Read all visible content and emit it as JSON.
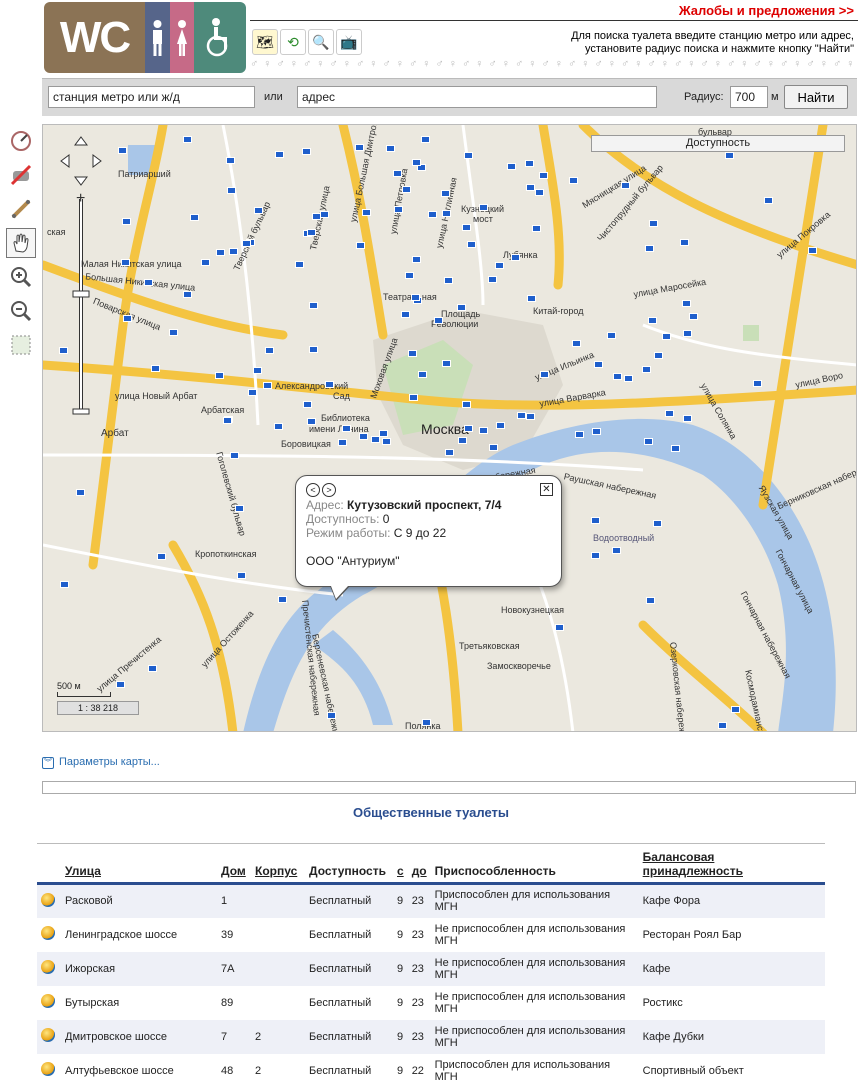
{
  "header": {
    "logo_text": "WC",
    "complaints_link": "Жалобы и предложения >>",
    "hint_line1": "Для поиска туалета введите станцию метро или адрес,",
    "hint_line2": "установите радиус поиска и нажмите кнопку \"Найти\"",
    "tool_icons": [
      "map-layers-icon",
      "route-icon",
      "magnifier-search-icon",
      "tv-icon"
    ]
  },
  "search": {
    "station_value": "станция метро или ж/д",
    "or_label": "или",
    "address_value": "адрес",
    "radius_label": "Радиус:",
    "radius_value": "700",
    "radius_unit": "м",
    "find_button": "Найти"
  },
  "left_tools": [
    "compass-icon",
    "no-drive-icon",
    "ruler-icon",
    "hand-pan-icon",
    "zoom-in-icon",
    "zoom-out-icon",
    "area-select-icon"
  ],
  "map": {
    "accessibility_button": "Доступность",
    "city_label": "Москва",
    "scale_text": "500 м",
    "scale_ratio": "1 : 38 218",
    "labels": {
      "patriarshiy": "Патриарший",
      "bulvar": "бульвар",
      "kuznetsky": "Кузнецкий",
      "most": "мост",
      "lubyanka": "Лубянка",
      "teatralnaya": "Театральная",
      "ploschad": "Площадь",
      "revolyutsii": "Революции",
      "kitay_gorod": "Китай-город",
      "aleksandrovsky": "Александровский",
      "sad": "Сад",
      "biblioteka": "Библиотека",
      "imeni_lenina": "имени Ленина",
      "arbatskaya": "Арбатская",
      "borovitskaya": "Боровицкая",
      "arbat": "Арбат",
      "kropotkinskaya": "Кропоткинская",
      "novokuznetskaya": "Новокузнецкая",
      "tretyakovskaya": "Третьяковская",
      "zamoskvorechye": "Замоскворечье",
      "polyanka": "Полянка",
      "vodootvodny": "Водоотводный",
      "skaya": "ская"
    },
    "streets": {
      "tverskaya": "Тверская улица",
      "b_dmitrovka": "улица Большая Дмитровка",
      "petrovka": "улица Петровка",
      "neglinnaya": "улица Неглинная",
      "tverskoy_bulvar": "Тверской бульвар",
      "m_nikitskaya": "Малая Никитская улица",
      "b_nikitskaya": "Большая Никитская улица",
      "povarskaya": "Поварская улица",
      "novy_arbat": "улица Новый Арбат",
      "mokhovaya": "Моховая улица",
      "gogolevsky": "Гоголевский бульвар",
      "prechistenka": "улица Пречистенка",
      "ostozhenka": "улица Остоженка",
      "ilyinka": "улица Ильинка",
      "varvarka": "улица Варварка",
      "maroseyka": "улица Маросейка",
      "pokrovka": "улица Покровка",
      "myasnitskaya": "Мясницкая улица",
      "solyanka": "улица Солянка",
      "raushskaya": "Раушская набережная",
      "bersenevskaya": "Берсеневская набережная",
      "bolotnaya": "Болотная набережная",
      "prechistenskaya": "Пречистенская набережная",
      "bernikovskaya": "Берниковская набережная",
      "gonchanaya": "Гончарная набережная",
      "goncharnaya_ul": "Гончарная улица",
      "yauzskaya": "Яузская улица",
      "ozerkovskaya": "Озерковская набережная",
      "kosmodamianskaya": "Космодамианская",
      "chistoprudny": "Чистопрудный бульвар",
      "vorontsovo": "улица Воро"
    },
    "popup": {
      "address_label": "Адрес:",
      "address_value": "Кутузовский проспект, 7/4",
      "access_label": "Доступность:",
      "access_value": "0",
      "hours_label": "Режим работы:",
      "hours_value": "С 9 до 22",
      "organization": "ООО \"Антуриум\""
    }
  },
  "params_link": "Параметры карты...",
  "table": {
    "title": "Общественные туалеты",
    "headers": {
      "street": "Улица",
      "house": "Дом",
      "building": "Корпус",
      "access": "Доступность",
      "from": "с",
      "to": "до",
      "adapt": "Приспособленность",
      "owner_line1": "Балансовая",
      "owner_line2": "принадлежность"
    },
    "rows": [
      {
        "street": "Расковой",
        "house": "1",
        "building": "",
        "access": "Бесплатный",
        "from": "9",
        "to": "23",
        "adapt": "Приспособлен для использования МГН",
        "owner": "Кафе Фора"
      },
      {
        "street": "Ленинградское шоссе",
        "house": "39",
        "building": "",
        "access": "Бесплатный",
        "from": "9",
        "to": "23",
        "adapt": "Не приспособлен для использования МГН",
        "owner": "Ресторан Роял Бар"
      },
      {
        "street": "Ижорская",
        "house": "7А",
        "building": "",
        "access": "Бесплатный",
        "from": "9",
        "to": "23",
        "adapt": "Не приспособлен для использования МГН",
        "owner": "Кафе"
      },
      {
        "street": "Бутырская",
        "house": "89",
        "building": "",
        "access": "Бесплатный",
        "from": "9",
        "to": "23",
        "adapt": "Не приспособлен для использования МГН",
        "owner": "Ростикс"
      },
      {
        "street": "Дмитровское шоссе",
        "house": "7",
        "building": "2",
        "access": "Бесплатный",
        "from": "9",
        "to": "23",
        "adapt": "Не приспособлен для использования МГН",
        "owner": "Кафе Дубки"
      },
      {
        "street": "Алтуфьевское шоссе",
        "house": "48",
        "building": "2",
        "access": "Бесплатный",
        "from": "9",
        "to": "22",
        "adapt": "Приспособлен для использования МГН",
        "owner": "Спортивный объект"
      }
    ]
  }
}
